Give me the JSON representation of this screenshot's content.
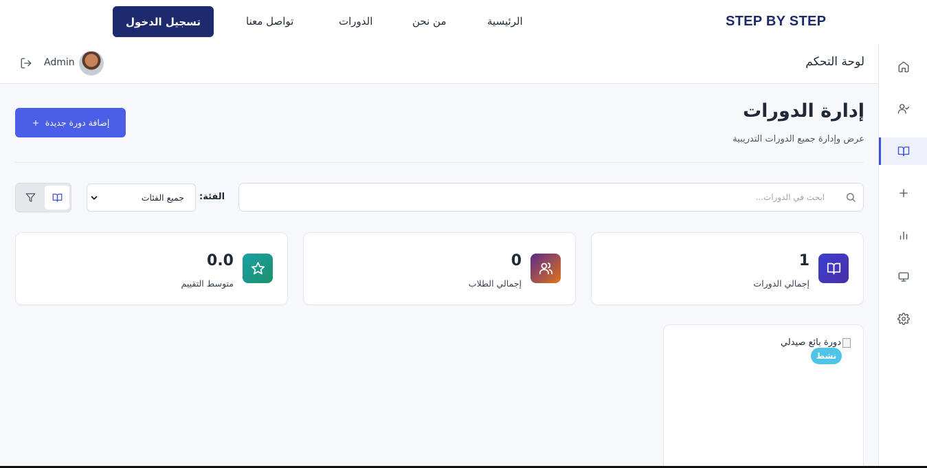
{
  "navbar": {
    "brand": "STEP BY STEP",
    "links": [
      "الرئيسية",
      "من نحن",
      "الدورات",
      "تواصل معنا"
    ],
    "login_label": "تسجيل الدخول"
  },
  "subheader": {
    "title": "لوحة التحكم",
    "user_name": "Admin"
  },
  "sidebar": {
    "items": [
      {
        "icon": "home-icon"
      },
      {
        "icon": "user-check-icon"
      },
      {
        "icon": "book-icon",
        "active": true
      },
      {
        "icon": "plus-icon"
      },
      {
        "icon": "bar-chart-icon"
      },
      {
        "icon": "monitor-icon"
      },
      {
        "icon": "settings-icon"
      }
    ]
  },
  "main": {
    "title": "إدارة الدورات",
    "subtitle": "عرض وإدارة جميع الدورات التدريبية",
    "add_button_label": "إضافة دورة جديدة",
    "search_placeholder": "ابحث في الدورات...",
    "category_label": "الفئة:",
    "category_selected": "جميع الفئات",
    "stats": [
      {
        "value": "1",
        "label": "إجمالي الدورات",
        "icon": "book-icon"
      },
      {
        "value": "0",
        "label": "إجمالي الطلاب",
        "icon": "users-icon"
      },
      {
        "value": "0.0",
        "label": "متوسط التقييم",
        "icon": "star-icon"
      }
    ],
    "course": {
      "image_alt": "دورة بائع صيدلي",
      "status": "نشط"
    }
  },
  "colors": {
    "brand": "#1e2a6e",
    "primary": "#4a5ee8",
    "status_active": "#4fc3e8"
  }
}
